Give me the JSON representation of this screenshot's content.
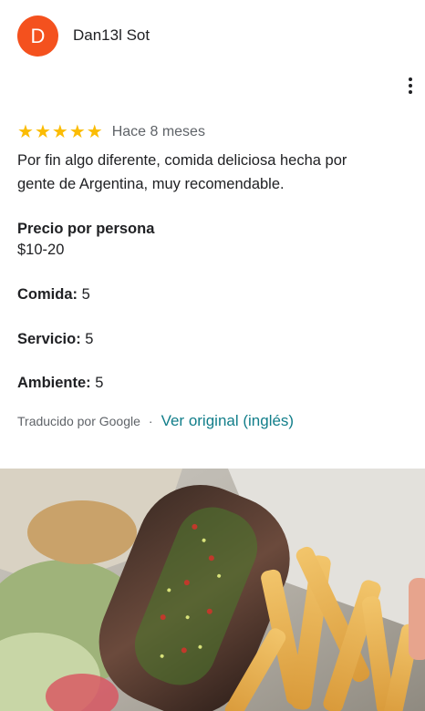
{
  "review": {
    "author": {
      "initial": "D",
      "name": "Dan13l Sot",
      "avatar_color": "#f4511e"
    },
    "rating": 5,
    "stars": [
      "★",
      "★",
      "★",
      "★",
      "★"
    ],
    "date": "Hace 8 meses",
    "text_line1": "Por fin algo diferente, comida deliciosa hecha por",
    "text_line2": "gente de Argentina, muy recomendable.",
    "price_label": "Precio por persona",
    "price_value": "$10-20",
    "food_label": "Comida:",
    "food_value": "5",
    "service_label": "Servicio:",
    "service_value": "5",
    "ambience_label": "Ambiente:",
    "ambience_value": "5",
    "translated_by": "Traducido por Google",
    "separator": "·",
    "see_original": "Ver original (inglés)",
    "photo_icon": "food-photo",
    "star_color": "#fbbc04",
    "link_color": "#127e8a"
  }
}
